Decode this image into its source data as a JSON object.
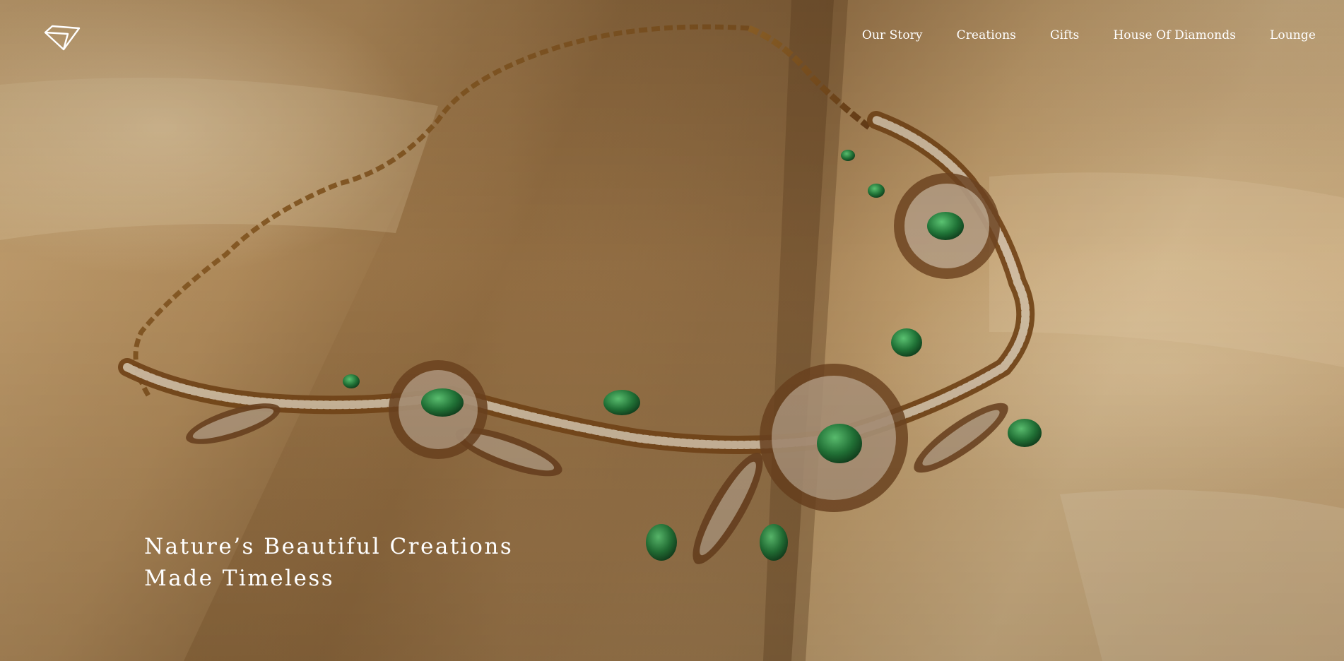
{
  "header": {
    "logo_icon": "diamond-logo-icon",
    "nav": [
      {
        "label": "Our Story"
      },
      {
        "label": "Creations"
      },
      {
        "label": "Gifts"
      },
      {
        "label": "House Of Diamonds"
      },
      {
        "label": "Lounge"
      }
    ]
  },
  "hero": {
    "image_icon": "jewellery-photo",
    "headline_line1": "Nature’s Beautiful Creations",
    "headline_line2": "Made Timeless"
  },
  "colors": {
    "text": "#ffffff",
    "gold": "#b8893e",
    "emerald": "#1f7a3a"
  }
}
